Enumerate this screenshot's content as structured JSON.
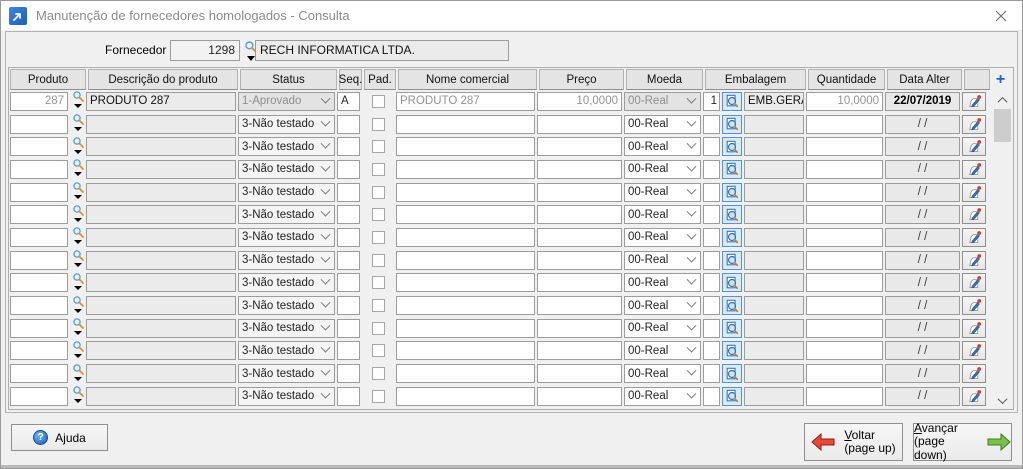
{
  "window": {
    "title": "Manutenção de fornecedores homologados - Consulta"
  },
  "fornecedor": {
    "label": "Fornecedor",
    "code": "1298",
    "name": "RECH INFORMATICA LTDA."
  },
  "table": {
    "headers": {
      "produto": "Produto",
      "descricao": "Descrição do produto",
      "status": "Status",
      "seq": "Seq.",
      "pad": "Pad.",
      "nome": "Nome comercial",
      "preco": "Preço",
      "moeda": "Moeda",
      "embalagem": "Embalagem",
      "quantidade": "Quantidade",
      "data_alter": "Data Alter",
      "blank": ""
    },
    "add_icon_label": "+",
    "rows": [
      {
        "filled": true,
        "produto": "287",
        "descricao": "PRODUTO 287",
        "status": "1-Aprovado",
        "seq": "A",
        "pad": false,
        "nome": "PRODUTO 287",
        "preco": "10,0000",
        "moeda": "00-Real",
        "emb_seq": "1",
        "emb_desc": "EMB.GERAL",
        "quantidade": "10,0000",
        "data_alter": "22/07/2019"
      },
      {
        "filled": false,
        "produto": "",
        "descricao": "",
        "status": "3-Não testado",
        "seq": "",
        "pad": false,
        "nome": "",
        "preco": "",
        "moeda": "00-Real",
        "emb_seq": "",
        "emb_desc": "",
        "quantidade": "",
        "data_alter": "/ /"
      },
      {
        "filled": false,
        "produto": "",
        "descricao": "",
        "status": "3-Não testado",
        "seq": "",
        "pad": false,
        "nome": "",
        "preco": "",
        "moeda": "00-Real",
        "emb_seq": "",
        "emb_desc": "",
        "quantidade": "",
        "data_alter": "/ /"
      },
      {
        "filled": false,
        "produto": "",
        "descricao": "",
        "status": "3-Não testado",
        "seq": "",
        "pad": false,
        "nome": "",
        "preco": "",
        "moeda": "00-Real",
        "emb_seq": "",
        "emb_desc": "",
        "quantidade": "",
        "data_alter": "/ /"
      },
      {
        "filled": false,
        "produto": "",
        "descricao": "",
        "status": "3-Não testado",
        "seq": "",
        "pad": false,
        "nome": "",
        "preco": "",
        "moeda": "00-Real",
        "emb_seq": "",
        "emb_desc": "",
        "quantidade": "",
        "data_alter": "/ /"
      },
      {
        "filled": false,
        "produto": "",
        "descricao": "",
        "status": "3-Não testado",
        "seq": "",
        "pad": false,
        "nome": "",
        "preco": "",
        "moeda": "00-Real",
        "emb_seq": "",
        "emb_desc": "",
        "quantidade": "",
        "data_alter": "/ /"
      },
      {
        "filled": false,
        "produto": "",
        "descricao": "",
        "status": "3-Não testado",
        "seq": "",
        "pad": false,
        "nome": "",
        "preco": "",
        "moeda": "00-Real",
        "emb_seq": "",
        "emb_desc": "",
        "quantidade": "",
        "data_alter": "/ /"
      },
      {
        "filled": false,
        "produto": "",
        "descricao": "",
        "status": "3-Não testado",
        "seq": "",
        "pad": false,
        "nome": "",
        "preco": "",
        "moeda": "00-Real",
        "emb_seq": "",
        "emb_desc": "",
        "quantidade": "",
        "data_alter": "/ /"
      },
      {
        "filled": false,
        "produto": "",
        "descricao": "",
        "status": "3-Não testado",
        "seq": "",
        "pad": false,
        "nome": "",
        "preco": "",
        "moeda": "00-Real",
        "emb_seq": "",
        "emb_desc": "",
        "quantidade": "",
        "data_alter": "/ /"
      },
      {
        "filled": false,
        "produto": "",
        "descricao": "",
        "status": "3-Não testado",
        "seq": "",
        "pad": false,
        "nome": "",
        "preco": "",
        "moeda": "00-Real",
        "emb_seq": "",
        "emb_desc": "",
        "quantidade": "",
        "data_alter": "/ /"
      },
      {
        "filled": false,
        "produto": "",
        "descricao": "",
        "status": "3-Não testado",
        "seq": "",
        "pad": false,
        "nome": "",
        "preco": "",
        "moeda": "00-Real",
        "emb_seq": "",
        "emb_desc": "",
        "quantidade": "",
        "data_alter": "/ /"
      },
      {
        "filled": false,
        "produto": "",
        "descricao": "",
        "status": "3-Não testado",
        "seq": "",
        "pad": false,
        "nome": "",
        "preco": "",
        "moeda": "00-Real",
        "emb_seq": "",
        "emb_desc": "",
        "quantidade": "",
        "data_alter": "/ /"
      },
      {
        "filled": false,
        "produto": "",
        "descricao": "",
        "status": "3-Não testado",
        "seq": "",
        "pad": false,
        "nome": "",
        "preco": "",
        "moeda": "00-Real",
        "emb_seq": "",
        "emb_desc": "",
        "quantidade": "",
        "data_alter": "/ /"
      },
      {
        "filled": false,
        "produto": "",
        "descricao": "",
        "status": "3-Não testado",
        "seq": "",
        "pad": false,
        "nome": "",
        "preco": "",
        "moeda": "00-Real",
        "emb_seq": "",
        "emb_desc": "",
        "quantidade": "",
        "data_alter": "/ /"
      }
    ]
  },
  "footer": {
    "help_label": "Ajuda",
    "help_icon_glyph": "?",
    "back_label": "Voltar",
    "back_sub": "(page up)",
    "forward_label": "Avançar",
    "forward_sub": "(page down)"
  }
}
